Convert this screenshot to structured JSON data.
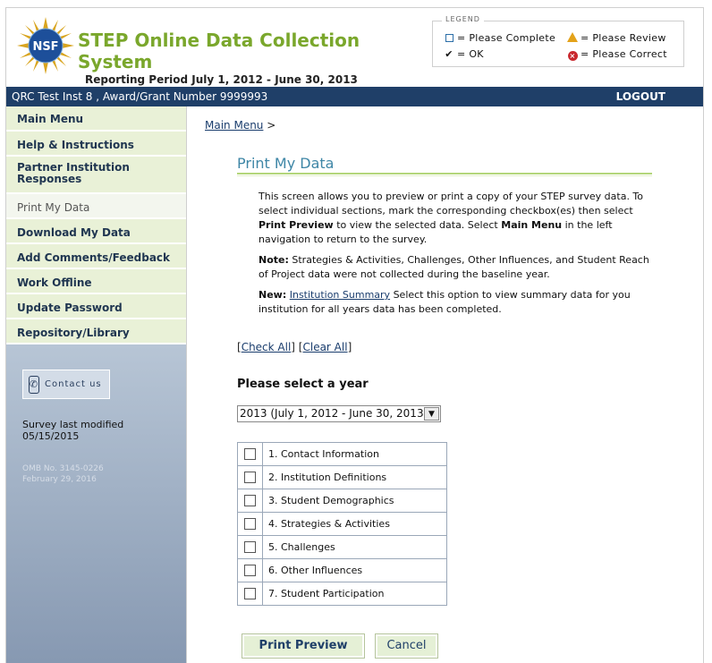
{
  "header": {
    "title": "STEP Online Data Collection System",
    "reporting_period": "Reporting Period July 1, 2012 - June 30, 2013",
    "logo_text": "NSF"
  },
  "legend": {
    "title": "LEGEND",
    "items": [
      {
        "icon": "empty-square-icon",
        "label": "= Please Complete"
      },
      {
        "icon": "warning-icon",
        "label": "= Please Review"
      },
      {
        "icon": "checkmark-icon",
        "label": "= OK"
      },
      {
        "icon": "error-icon",
        "label": "= Please Correct"
      }
    ]
  },
  "topbar": {
    "user_info": "QRC Test Inst 8 , Award/Grant Number 9999993",
    "logout": "LOGOUT"
  },
  "sidebar": {
    "items": [
      {
        "label": "Main Menu"
      },
      {
        "label": "Help & Instructions"
      },
      {
        "label": "Partner Institution Responses"
      },
      {
        "label": "Print My Data"
      },
      {
        "label": "Download My Data"
      },
      {
        "label": "Add Comments/Feedback"
      },
      {
        "label": "Work Offline"
      },
      {
        "label": "Update Password"
      },
      {
        "label": "Repository/Library"
      }
    ],
    "contact": "Contact us",
    "survey_modified_label": "Survey last modified",
    "survey_modified_date": "05/15/2015",
    "omb_no": "OMB No. 3145-0226",
    "omb_date": "February 29, 2016"
  },
  "main": {
    "breadcrumb_link": "Main Menu",
    "breadcrumb_sep": ">",
    "page_title": "Print My Data",
    "intro_1": "This screen allows you to preview or print a copy of your STEP survey data. To select individual sections, mark the corresponding checkbox(es) then select",
    "intro_bold_1": "Print Preview",
    "intro_2": "to view the selected data. Select",
    "intro_bold_2": "Main Menu",
    "intro_3": "in the left navigation to return to the survey.",
    "note_label": "Note:",
    "note_text": "Strategies & Activities, Challenges, Other Influences, and Student Reach of Project data were not collected during the baseline year.",
    "new_label": "New:",
    "new_link": "Institution Summary",
    "new_text": "Select this option to view summary data for you institution for all years data has been completed.",
    "check_all": "Check All",
    "clear_all": "Clear All",
    "year_label": "Please select a year",
    "year_selected": "2013 (July 1, 2012 - June 30, 2013)",
    "sections": [
      "1. Contact Information",
      "2. Institution Definitions",
      "3. Student Demographics",
      "4. Strategies & Activities",
      "5. Challenges",
      "6. Other Influences",
      "7. Student Participation"
    ],
    "print_preview": "Print Preview",
    "cancel": "Cancel"
  },
  "colors": {
    "brand_green": "#7aa72c",
    "nav_blue": "#1f3f68",
    "title_blue": "#3e86a6"
  }
}
